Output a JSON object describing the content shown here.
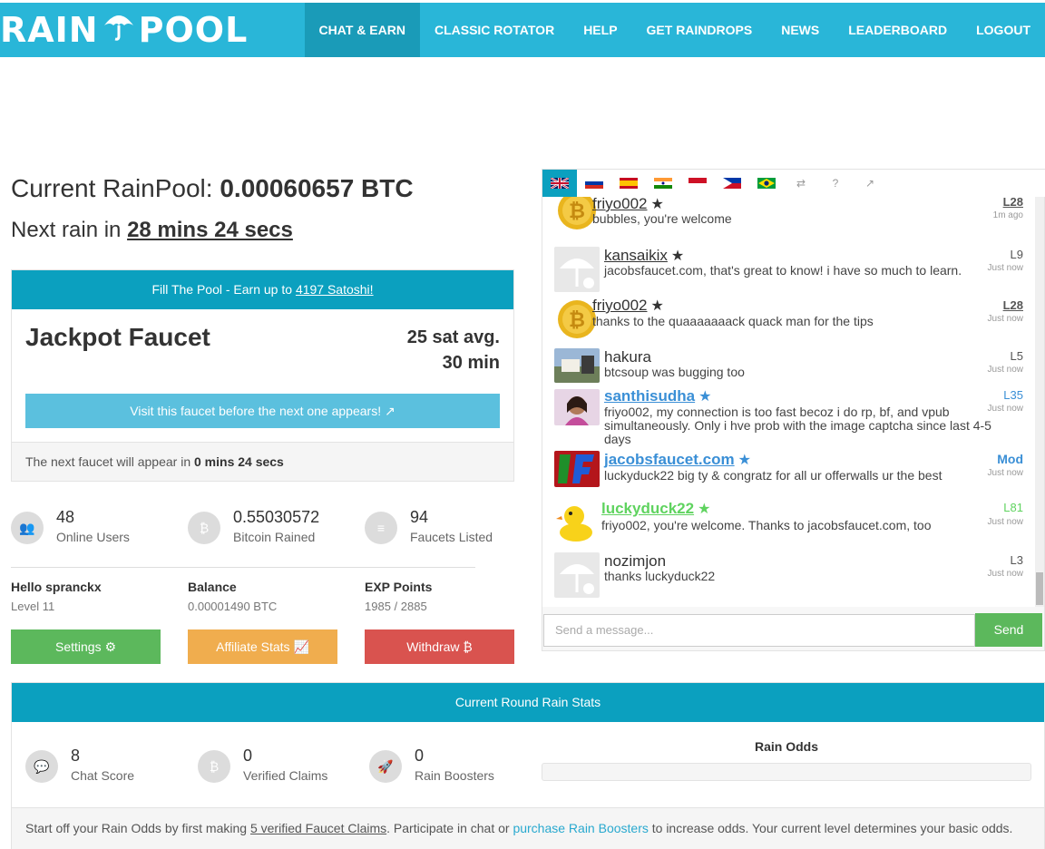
{
  "brand": {
    "logo_text_left": "RAIN",
    "logo_text_right": "POOL",
    "logo_glyph": "umbrella-drop-icon"
  },
  "nav": {
    "items": [
      "CHAT & EARN",
      "CLASSIC ROTATOR",
      "HELP",
      "GET RAINDROPS",
      "NEWS",
      "LEADERBOARD",
      "LOGOUT"
    ],
    "active": "CHAT & EARN"
  },
  "pool": {
    "label": "Current RainPool:",
    "value": "0.00060657 BTC"
  },
  "rain": {
    "label": "Next rain in",
    "value": "28 mins 24 secs"
  },
  "faucet": {
    "header_prefix": "Fill The Pool - Earn up to",
    "header_link": "4197 Satoshi!",
    "name": "Jackpot Faucet",
    "avg": "25 sat avg.",
    "interval": "30 min",
    "visit_label": "Visit this faucet before the next one appears! ↗",
    "footer_prefix": "The next faucet will appear in",
    "footer_value": "0 mins 24 secs"
  },
  "stats": [
    {
      "icon": "users-icon",
      "glyph": "👥",
      "value": "48",
      "label": "Online Users"
    },
    {
      "icon": "bitcoin-icon",
      "glyph": "₿",
      "value": "0.55030572",
      "label": "Bitcoin Rained"
    },
    {
      "icon": "list-icon",
      "glyph": "≡",
      "value": "94",
      "label": "Faucets Listed"
    }
  ],
  "account": {
    "hello": "Hello spranckx",
    "level": "Level 11",
    "balance_label": "Balance",
    "balance": "0.00001490 BTC",
    "exp_label": "EXP Points",
    "exp": "1985 / 2885"
  },
  "buttons": {
    "settings": "Settings ⚙",
    "affiliate": "Affiliate Stats 📈",
    "withdraw": "Withdraw ₿"
  },
  "colors": {
    "primary": "#0ba0bf",
    "nav": "#29b6d8",
    "green": "#5cb85c",
    "orange": "#f0ad4e",
    "red": "#d9534f",
    "info": "#5bc0de"
  },
  "chat": {
    "flags": [
      "uk-flag",
      "russia-flag",
      "spain-flag",
      "india-flag",
      "indonesia-flag",
      "philippines-flag",
      "brazil-flag"
    ],
    "tools": [
      "⇄",
      "?",
      "↗"
    ],
    "messages": [
      {
        "user": "friyo002",
        "star": true,
        "text": "bubbles, you're welcome",
        "level": "L28",
        "time": "1m ago",
        "avatar": "bitcoin-avatar",
        "color": "#333"
      },
      {
        "user": "kansaikix",
        "star": true,
        "text": "jacobsfaucet.com, that's great to know! i have so much to learn.",
        "level": "L9",
        "time": "Just now",
        "avatar": "umbrella-avatar",
        "color": "#333"
      },
      {
        "user": "friyo002",
        "star": true,
        "text": "thanks to the quaaaaaaack quack man for the tips",
        "level": "L28",
        "time": "Just now",
        "avatar": "bitcoin-avatar",
        "color": "#333"
      },
      {
        "user": "hakura",
        "star": false,
        "text": "btcsoup was bugging too",
        "level": "L5",
        "time": "Just now",
        "avatar": "photo-avatar",
        "color": "#333"
      },
      {
        "user": "santhisudha",
        "star": true,
        "text": "friyo002, my connection is too fast becoz i do rp, bf, and vpub simultaneously. Only i hve prob with the image captcha since last 4-5 days",
        "level": "L35",
        "time": "Just now",
        "avatar": "photo-avatar",
        "color": "#3a8fd6"
      },
      {
        "user": "jacobsfaucet.com",
        "star": true,
        "text": "luckyduck22 big ty & congratz for all ur offerwalls ur the best",
        "level": "Mod",
        "time": "Just now",
        "avatar": "jf-avatar",
        "color": "#3a8fd6"
      },
      {
        "user": "luckyduck22",
        "star": true,
        "text": "friyo002, you're welcome. Thanks to jacobsfaucet.com, too",
        "level": "L81",
        "time": "Just now",
        "avatar": "duck-avatar",
        "color": "#5fd35f"
      },
      {
        "user": "nozimjon",
        "star": false,
        "text": "thanks luckyduck22",
        "level": "L3",
        "time": "Just now",
        "avatar": "umbrella-avatar",
        "color": "#333"
      }
    ],
    "input_placeholder": "Send a message...",
    "send_label": "Send"
  },
  "round": {
    "title": "Current Round Rain Stats",
    "stats": [
      {
        "icon": "chat-icon",
        "glyph": "💬",
        "value": "8",
        "label": "Chat Score"
      },
      {
        "icon": "bitcoin-icon",
        "glyph": "₿",
        "value": "0",
        "label": "Verified Claims"
      },
      {
        "icon": "rocket-icon",
        "glyph": "🚀",
        "value": "0",
        "label": "Rain Boosters"
      }
    ],
    "odds_title": "Rain Odds",
    "odds_fraction": 0,
    "footer_1": "Start off your Rain Odds by first making",
    "footer_link_1": "5 verified Faucet Claims",
    "footer_2": ". Participate in chat or",
    "footer_link_2": "purchase Rain Boosters",
    "footer_3": "to increase odds. Your current level determines your basic odds."
  }
}
